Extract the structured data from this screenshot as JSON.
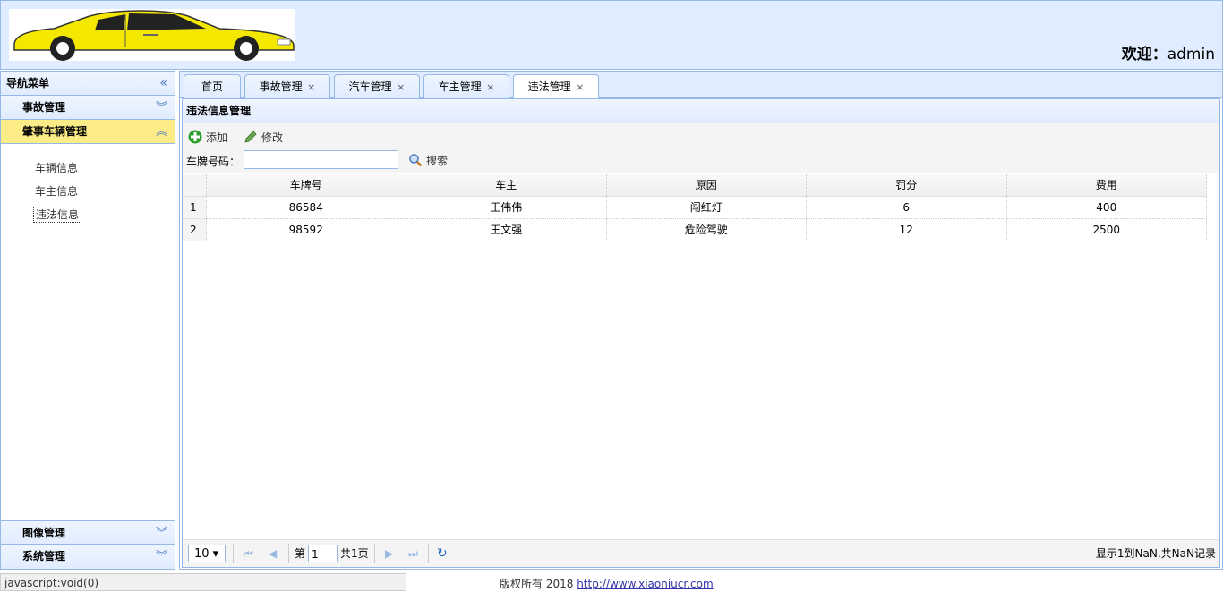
{
  "header": {
    "welcome_label": "欢迎：",
    "username": "admin"
  },
  "sidebar": {
    "title": "导航菜单",
    "collapse_glyph": "«",
    "sections": [
      {
        "label": "事故管理",
        "expanded": false
      },
      {
        "label": "肇事车辆管理",
        "expanded": true,
        "items": [
          "车辆信息",
          "车主信息",
          "违法信息"
        ],
        "selected": "违法信息"
      },
      {
        "label": "图像管理",
        "expanded": false
      },
      {
        "label": "系统管理",
        "expanded": false
      }
    ]
  },
  "tabs": [
    {
      "label": "首页",
      "closable": false
    },
    {
      "label": "事故管理",
      "closable": true
    },
    {
      "label": "汽车管理",
      "closable": true
    },
    {
      "label": "车主管理",
      "closable": true
    },
    {
      "label": "违法管理",
      "closable": true,
      "selected": true
    }
  ],
  "panel": {
    "title": "违法信息管理",
    "toolbar": {
      "add_label": "添加",
      "edit_label": "修改",
      "search_field_label": "车牌号码：",
      "search_value": "",
      "search_button_label": "搜索"
    }
  },
  "grid": {
    "columns": [
      "车牌号",
      "车主",
      "原因",
      "罚分",
      "费用"
    ],
    "rows": [
      {
        "num": "1",
        "cells": [
          "86584",
          "王伟伟",
          "闯红灯",
          "6",
          "400"
        ]
      },
      {
        "num": "2",
        "cells": [
          "98592",
          "王文强",
          "危险驾驶",
          "12",
          "2500"
        ]
      }
    ]
  },
  "pager": {
    "page_size": "10",
    "page_prefix": "第",
    "page_number": "1",
    "page_total": "共1页",
    "summary": "显示1到NaN,共NaN记录"
  },
  "status_bar": "javascript:void(0)",
  "footer": {
    "copyright": "版权所有 2018",
    "link": "http://www.xiaoniucr.com"
  },
  "colors": {
    "accent_border": "#95b8e7",
    "panel_bg": "#e0ecff",
    "active_section": "#fbec88",
    "car_body": "#f5e800"
  }
}
